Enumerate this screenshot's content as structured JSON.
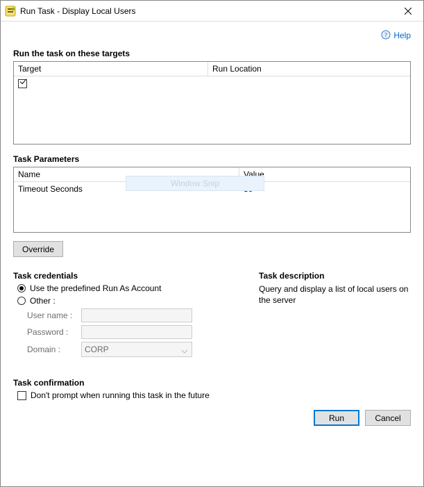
{
  "window": {
    "title": "Run Task - Display Local Users"
  },
  "help": {
    "label": "Help"
  },
  "targets": {
    "heading": "Run the task on these targets",
    "columns": {
      "target": "Target",
      "run_location": "Run Location"
    }
  },
  "watermark": "Window Snip",
  "parameters": {
    "heading": "Task Parameters",
    "columns": {
      "name": "Name",
      "value": "Value"
    },
    "rows": [
      {
        "name": "Timeout Seconds",
        "value": "30"
      }
    ]
  },
  "override_label": "Override",
  "credentials": {
    "heading": "Task credentials",
    "option_predefined": "Use the predefined Run As Account",
    "option_other": "Other :",
    "labels": {
      "username": "User name :",
      "password": "Password :",
      "domain": "Domain :"
    },
    "domain_value": "CORP"
  },
  "description": {
    "heading": "Task description",
    "text": "Query and display a list of local users on the server"
  },
  "confirmation": {
    "heading": "Task confirmation",
    "label": "Don't prompt when running this task in the future"
  },
  "footer": {
    "run": "Run",
    "cancel": "Cancel"
  }
}
